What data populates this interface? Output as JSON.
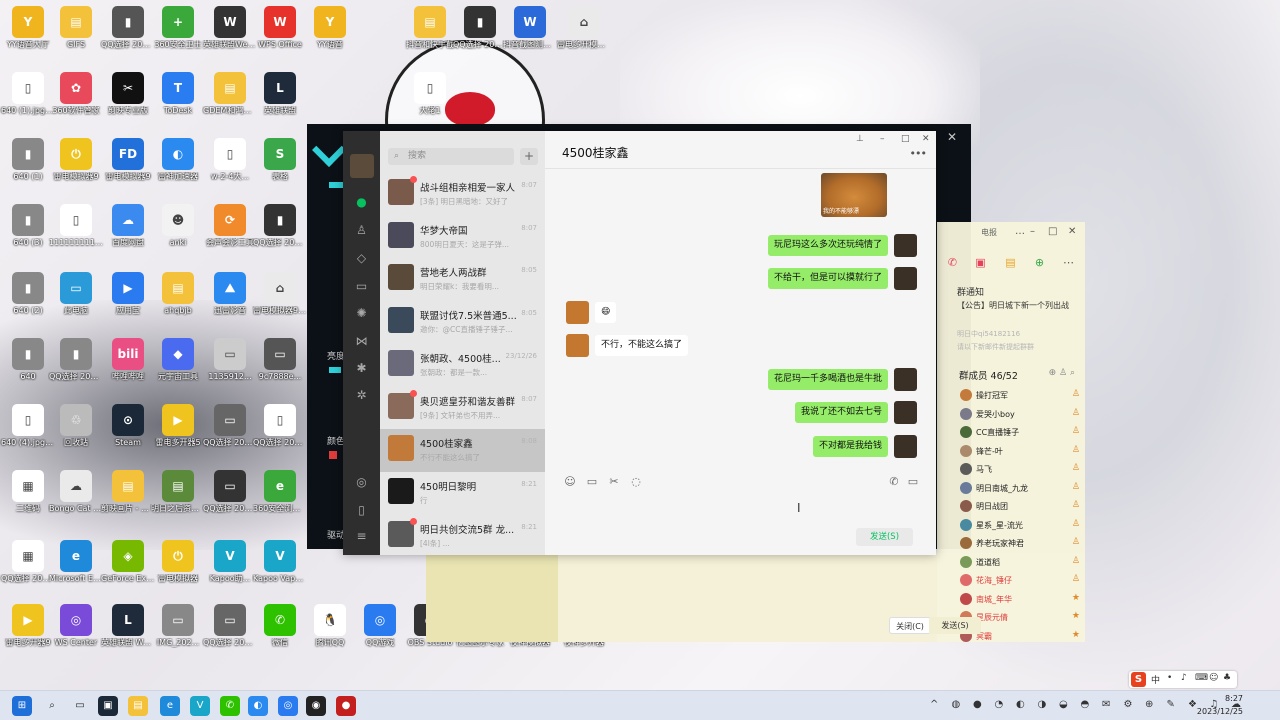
{
  "desktop": {
    "icons": [
      {
        "label": "YY语音大厅",
        "color": "#f0b41e",
        "glyph": "Y"
      },
      {
        "label": "GIFS",
        "color": "#f3c23a",
        "glyph": "▤"
      },
      {
        "label": "QQ选择 20231115...",
        "color": "#555555",
        "glyph": "▮"
      },
      {
        "label": "360安全卫士",
        "color": "#3aa83a",
        "glyph": "+"
      },
      {
        "label": "英雄联盟WeGame版",
        "color": "#333333",
        "glyph": "W"
      },
      {
        "label": "WPS Office",
        "color": "#e7322b",
        "glyph": "W"
      },
      {
        "label": "YY语音",
        "color": "#f0b41e",
        "glyph": "Y"
      },
      {
        "label": "抖音和快手截",
        "color": "#f3c23a",
        "glyph": "▤"
      },
      {
        "label": "QQ选择 2023111...",
        "color": "#333333",
        "glyph": "▮"
      },
      {
        "label": "抖音截图测试报告",
        "color": "#2c6ad9",
        "glyph": "W"
      },
      {
        "label": "雷电多开模拟器 - 快捷方式",
        "color": "#eaeaea",
        "glyph": "⌂"
      },
      {
        "label": "640 (1).jpg.wx...",
        "color": "#ffffff",
        "glyph": "▯"
      },
      {
        "label": "360软件管家",
        "color": "#e94a5b",
        "glyph": "✿"
      },
      {
        "label": "剪映专业版",
        "color": "#111111",
        "glyph": "✂"
      },
      {
        "label": "ToDesk",
        "color": "#2a7df0",
        "glyph": "T"
      },
      {
        "label": "GDEM和鸿蒙 bongocat",
        "color": "#f3c23a",
        "glyph": "▤"
      },
      {
        "label": "英雄联盟",
        "color": "#1f2a3a",
        "glyph": "L"
      },
      {
        "label": "640 (1)",
        "color": "#888888",
        "glyph": "▮"
      },
      {
        "label": "雷电模拟器9",
        "color": "#f0c41e",
        "glyph": "⏻"
      },
      {
        "label": "雷电模拟器9",
        "color": "#2270d9",
        "glyph": "FD"
      },
      {
        "label": "雷神加速器",
        "color": "#2a8af0",
        "glyph": "◐"
      },
      {
        "label": "w-2-4大...",
        "color": "#ffffff",
        "glyph": "▯"
      },
      {
        "label": "表格",
        "color": "#3aa84a",
        "glyph": "S"
      },
      {
        "label": "640 (3)",
        "color": "#888888",
        "glyph": "▮"
      },
      {
        "label": "1111111111...",
        "color": "#ffffff",
        "glyph": "▯"
      },
      {
        "label": "百度网盘",
        "color": "#3a8af0",
        "glyph": "☁"
      },
      {
        "label": "anki",
        "color": "#f2f2f2",
        "glyph": "☻"
      },
      {
        "label": "会声会影工具",
        "color": "#f08a2a",
        "glyph": "⟳"
      },
      {
        "label": "QQ选择 20231115...",
        "color": "#333333",
        "glyph": "▮"
      },
      {
        "label": "640 (2)",
        "color": "#888888",
        "glyph": "▮"
      },
      {
        "label": "此电脑",
        "color": "#2a9ad9",
        "glyph": "▭"
      },
      {
        "label": "应用宝",
        "color": "#2a7af0",
        "glyph": "▶"
      },
      {
        "label": "ahqbjb",
        "color": "#f3c23a",
        "glyph": "▤"
      },
      {
        "label": "迅雷影音",
        "color": "#2a8af0",
        "glyph": "⛰"
      },
      {
        "label": "雷电模拟器9 - 快捷方式",
        "color": "#eaeaea",
        "glyph": "⌂"
      },
      {
        "label": "640",
        "color": "#888888",
        "glyph": "▮"
      },
      {
        "label": "QQ选择 2023112...",
        "color": "#888888",
        "glyph": "▮"
      },
      {
        "label": "哔哩哔哩",
        "color": "#ea4f84",
        "glyph": "bili"
      },
      {
        "label": "元宇宙工具",
        "color": "#4a6af0",
        "glyph": "◆"
      },
      {
        "label": "1135912...",
        "color": "#cccccc",
        "glyph": "▭"
      },
      {
        "label": "9c7888e...",
        "color": "#555555",
        "glyph": "▭"
      },
      {
        "label": "640 (4).jpg.wx...",
        "color": "#ffffff",
        "glyph": "▯"
      },
      {
        "label": "回收站",
        "color": "#bbbbbb",
        "glyph": "♲"
      },
      {
        "label": "Steam",
        "color": "#1b2838",
        "glyph": "⊙"
      },
      {
        "label": "雷电多开器5",
        "color": "#f0c41e",
        "glyph": "▶"
      },
      {
        "label": "QQ选择 20231115...",
        "color": "#666666",
        "glyph": "▭"
      },
      {
        "label": "QQ选择 2023112...",
        "color": "#ffffff",
        "glyph": "▯"
      },
      {
        "label": "二维码",
        "color": "#ffffff",
        "glyph": "▦"
      },
      {
        "label": "Bongo Cat Mver - 快...",
        "color": "#eaeaea",
        "glyph": "☁"
      },
      {
        "label": "剪映画片 - 快捷方式",
        "color": "#f3c23a",
        "glyph": "▤"
      },
      {
        "label": "明日之后资料 - 快捷方式",
        "color": "#5a8a3a",
        "glyph": "▤"
      },
      {
        "label": "QQ选择 2023112...",
        "color": "#333333",
        "glyph": "▭"
      },
      {
        "label": "360安全浏览器",
        "color": "#3aa83a",
        "glyph": "e"
      },
      {
        "label": "QQ选择 2023111...",
        "color": "#ffffff",
        "glyph": "▦"
      },
      {
        "label": "Microsoft Edge",
        "color": "#1f8ad9",
        "glyph": "e"
      },
      {
        "label": "GeForce Experience",
        "color": "#76b900",
        "glyph": "◈"
      },
      {
        "label": "雷电模拟器",
        "color": "#f0c41e",
        "glyph": "⏻"
      },
      {
        "label": "Kapoo助...",
        "color": "#1aa6c8",
        "glyph": "V"
      },
      {
        "label": "Kapoo Vapoo助手",
        "color": "#1aa6c8",
        "glyph": "V"
      },
      {
        "label": "雷电多开器9",
        "color": "#f0c41e",
        "glyph": "▶"
      },
      {
        "label": "WS Center",
        "color": "#7a4ad9",
        "glyph": "◎"
      },
      {
        "label": "英雄联盟 WeGame版",
        "color": "#1f2a3a",
        "glyph": "L"
      },
      {
        "label": "IMG_202...",
        "color": "#888888",
        "glyph": "▭"
      },
      {
        "label": "QQ选择 20231125...",
        "color": "#666666",
        "glyph": "▭"
      },
      {
        "label": "微信",
        "color": "#2dc100",
        "glyph": "✆"
      },
      {
        "label": "腾讯QQ",
        "color": "#ffffff",
        "glyph": "🐧"
      },
      {
        "label": "QQ游戏",
        "color": "#2a7af0",
        "glyph": "◎"
      },
      {
        "label": "OBS Studio",
        "color": "#333333",
        "glyph": "◉"
      },
      {
        "label": "亿图图示专家",
        "color": "#eaeaea",
        "glyph": "▭"
      },
      {
        "label": "夜神模拟器",
        "color": "#eaeaea",
        "glyph": "▭"
      },
      {
        "label": "夜神多开器",
        "color": "#eaeaea",
        "glyph": "▭"
      }
    ],
    "wallpaper_label": "大佬1"
  },
  "launcher": {
    "close": "✕",
    "labels": [
      "亮度",
      "颜色",
      "驱动"
    ]
  },
  "wechat": {
    "search_placeholder": "搜索",
    "add_label": "+",
    "chat_title": "4500桂家鑫",
    "more": "•••",
    "window_controls": [
      "⊥",
      "–",
      "□",
      "✕"
    ],
    "chats": [
      {
        "name": "战斗组相亲相爱一家人",
        "time": "8:07",
        "preview": "[3条] 明日黑暗地：又好了",
        "unread": true
      },
      {
        "name": "华梦大帝国",
        "time": "8:07",
        "preview": "800明日夏天：这是子弹...",
        "unread": false
      },
      {
        "name": "营地老人两战群",
        "time": "8:05",
        "preview": "明日荣耀k：我要看明...",
        "unread": false
      },
      {
        "name": "联盟讨伐7.5米普通5...",
        "time": "8:05",
        "preview": "邀你：@CC直播锤子锤子...",
        "unread": false
      },
      {
        "name": "张朝政、4500桂...",
        "time": "23/12/26",
        "preview": "张朝政：都是一款...",
        "unread": false
      },
      {
        "name": "奥贝遮皇芬和谐友善群",
        "time": "8:07",
        "preview": "[9条] 文轩弟也不用弄...",
        "unread": true
      },
      {
        "name": "4500桂家鑫",
        "time": "8:08",
        "preview": "不行不能这么搞了",
        "unread": false,
        "selected": true
      },
      {
        "name": "450明日黎明",
        "time": "8:21",
        "preview": "行",
        "unread": false
      },
      {
        "name": "明日共创交流5群 龙...",
        "time": "8:21",
        "preview": "[4l条] ...",
        "unread": true
      }
    ],
    "messages": [
      {
        "side": "right",
        "text": "玩尼玛这么多次还玩纯情了"
      },
      {
        "side": "right",
        "text": "不给干，但是可以摸就行了"
      },
      {
        "side": "left",
        "text": "😄"
      },
      {
        "side": "left",
        "text": "不行，不能这么搞了"
      },
      {
        "side": "right",
        "text": "花尼玛一千多喝酒也是牛批"
      },
      {
        "side": "right",
        "text": "我说了还不如去七号"
      },
      {
        "side": "right",
        "text": "不对都是我给钱"
      }
    ],
    "photo_caption": "我的不能够漂",
    "toolbar_icons": [
      "☺",
      "▭",
      "✂",
      "◌"
    ],
    "call_icons": [
      "✆",
      "▭"
    ],
    "send_label": "发送(S)",
    "cursor": "I"
  },
  "qq": {
    "title": "电报",
    "controls": [
      "…",
      "–",
      "□",
      "✕"
    ],
    "notice_heading": "群通知",
    "notice_text": "【公告】明日城下新一个列出战",
    "notice_grey_1": "明日中qi54182116",
    "notice_grey_2": "请以下新邮件新提起群群",
    "members_heading": "群成员 46/52",
    "member_tools": "⊕ ♙ ⌕",
    "members": [
      {
        "name": "操打冠军",
        "red": false
      },
      {
        "name": "爱哭小boy",
        "red": false
      },
      {
        "name": "CC直播锤子",
        "red": false
      },
      {
        "name": "锋芒-叶",
        "red": false
      },
      {
        "name": "马飞",
        "red": false
      },
      {
        "name": "明日南城_九龙",
        "red": false
      },
      {
        "name": "明日战团",
        "red": false
      },
      {
        "name": "星系_星-流光",
        "red": false
      },
      {
        "name": "养老玩家神君",
        "red": false
      },
      {
        "name": "道道稻",
        "red": false
      },
      {
        "name": "花海_锤仔",
        "red": true
      },
      {
        "name": "南城_年华",
        "red": true
      },
      {
        "name": "星辰元倩",
        "red": true
      },
      {
        "name": "冥霸",
        "red": true
      }
    ],
    "close_btn": "关闭(C)",
    "send_btn": "发送(S)"
  },
  "taskbar": {
    "apps": [
      "⊞",
      "⌕",
      "▭",
      "▣",
      "▤",
      "e",
      "V",
      "✆",
      "◐",
      "◎",
      "◉",
      "●"
    ],
    "tray": [
      "^",
      "◍",
      "●",
      "◔",
      "◐",
      "◑",
      "◒",
      "◓",
      "✉",
      "⚙",
      "⊕",
      "✎",
      "❖",
      "♫",
      "☁"
    ],
    "ime_labels": [
      "中",
      "•",
      "♪",
      "⌨",
      "☺",
      "♣"
    ],
    "time": "8:27",
    "date": "2023/12/25"
  }
}
